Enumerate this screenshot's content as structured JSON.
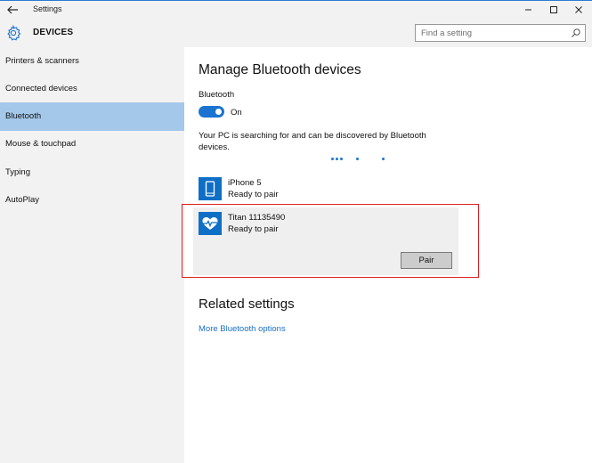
{
  "window": {
    "app_title": "Settings",
    "section_title": "DEVICES"
  },
  "search": {
    "placeholder": "Find a setting"
  },
  "sidebar": {
    "items": [
      {
        "label": "Printers & scanners",
        "selected": false
      },
      {
        "label": "Connected devices",
        "selected": false
      },
      {
        "label": "Bluetooth",
        "selected": true
      },
      {
        "label": "Mouse & touchpad",
        "selected": false
      },
      {
        "label": "Typing",
        "selected": false
      },
      {
        "label": "AutoPlay",
        "selected": false
      }
    ]
  },
  "main": {
    "title": "Manage Bluetooth devices",
    "bluetooth_label": "Bluetooth",
    "toggle_state": "On",
    "searching_text": "Your PC is searching for and can be discovered by Bluetooth devices.",
    "devices": [
      {
        "name": "iPhone 5",
        "status": "Ready to pair",
        "icon": "phone-icon"
      },
      {
        "name": "Titan 11135490",
        "status": "Ready to pair",
        "icon": "heart-rate-icon"
      }
    ],
    "pair_button": "Pair",
    "related_title": "Related settings",
    "related_link": "More Bluetooth options"
  },
  "colors": {
    "accent": "#1a73d0",
    "selected_nav": "#a4c8ea",
    "highlight": "#e02020",
    "link": "#1a6fc4"
  }
}
